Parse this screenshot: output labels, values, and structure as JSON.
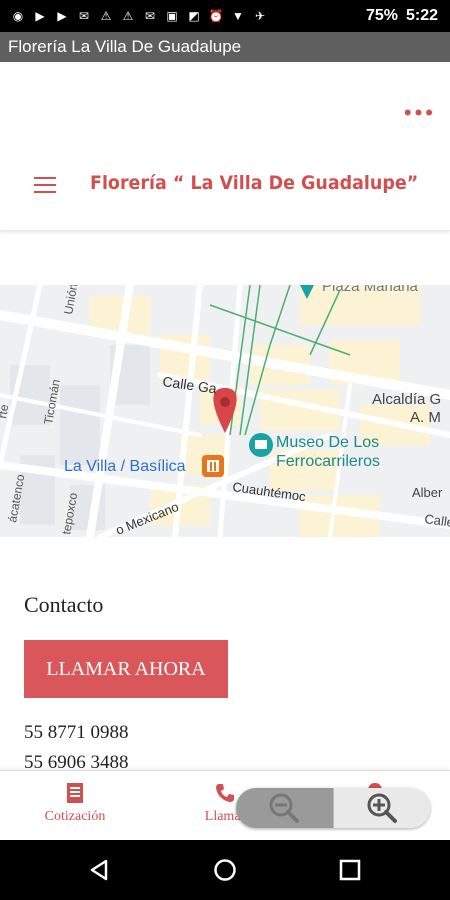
{
  "status_bar": {
    "battery": "75%",
    "time": "5:22"
  },
  "window": {
    "title": "Florería La Villa De Guadalupe"
  },
  "header": {
    "brand": "Florería “ La Villa De Guadalupe”",
    "more_glyph": "•••"
  },
  "map": {
    "labels": {
      "plaza": "Plaza Mariana",
      "calle": "Calle Ga",
      "alcaldia1": "Alcaldía G",
      "alcaldia2": "A. M",
      "museo1": "Museo De Los",
      "museo2": "Ferrocarrileros",
      "station": "La Villa / Basílica",
      "cuauhtemoc": "Cuauhtémoc",
      "mexicano": "o Mexicano",
      "union": "Unión",
      "ticoman": "Ticomán",
      "atzacoalco": "ácatenco",
      "tepoxco": "tepoxco",
      "albert": "Alber",
      "calle2": "Calle",
      "rte": "rte"
    }
  },
  "contact": {
    "title": "Contacto",
    "call_button": "LLAMAR AHORA",
    "phones": [
      "55 8771 0988",
      "55 6906 3488"
    ]
  },
  "bottom_nav": {
    "quote_label": "Cotización",
    "call_label": "Llamar"
  },
  "colors": {
    "accent": "#d14f4f",
    "button": "#d9575a",
    "map_pin": "#d9464a",
    "museum_teal": "#1aa3a3",
    "metro_orange": "#e8751a"
  }
}
